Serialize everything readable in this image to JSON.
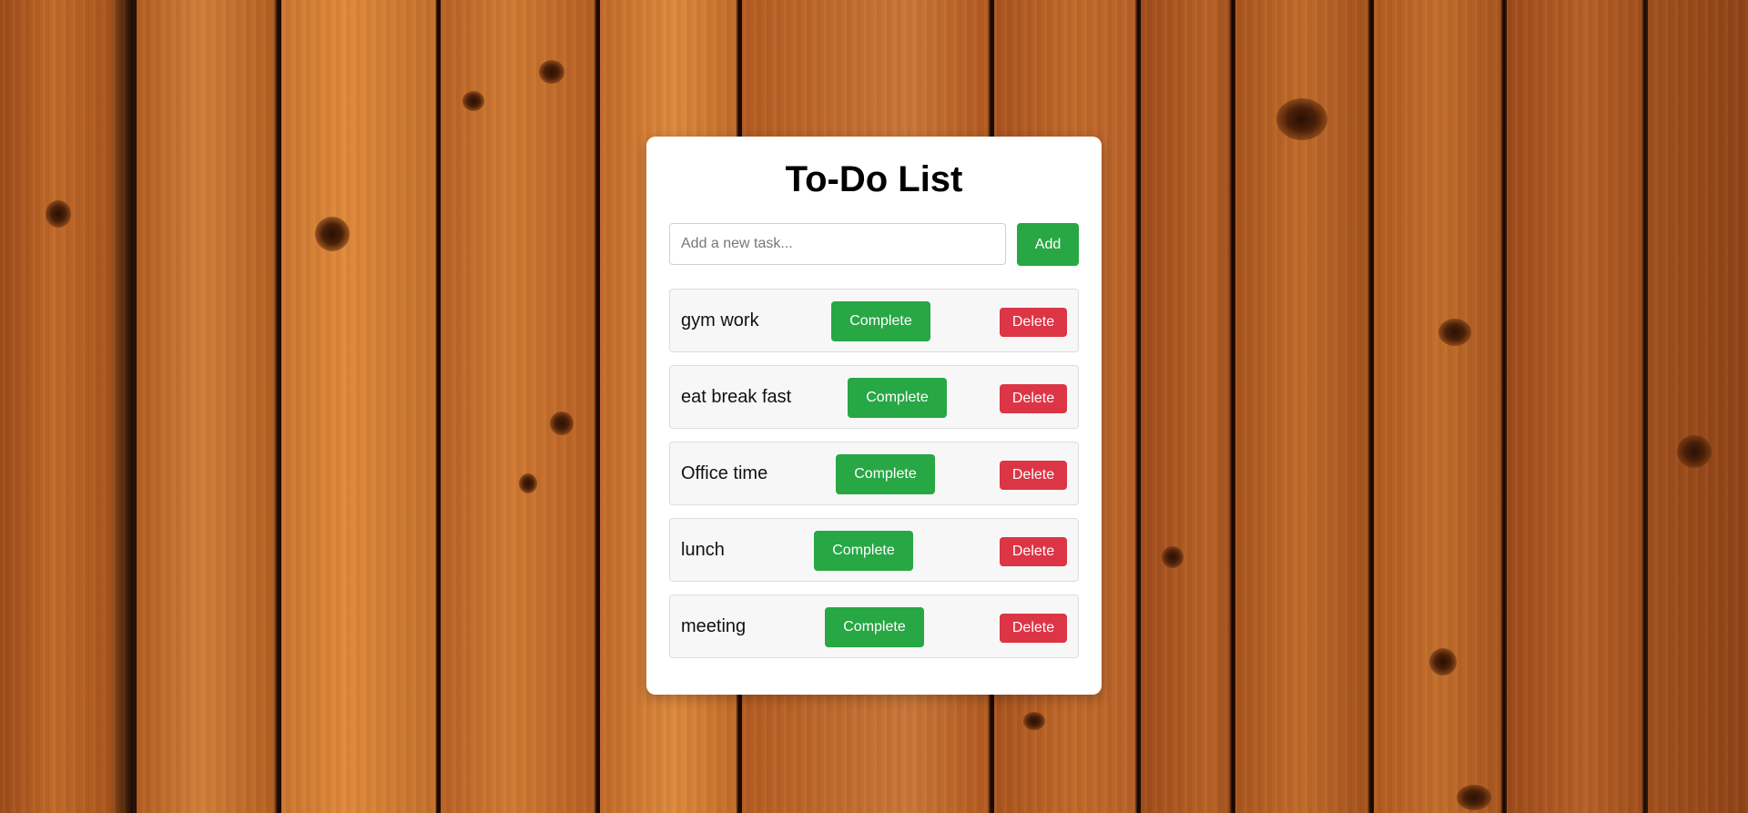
{
  "title": "To-Do List",
  "input": {
    "placeholder": "Add a new task...",
    "value": ""
  },
  "add_button_label": "Add",
  "tasks": [
    {
      "text": "gym work",
      "complete_label": "Complete",
      "delete_label": "Delete"
    },
    {
      "text": "eat break fast",
      "complete_label": "Complete",
      "delete_label": "Delete"
    },
    {
      "text": "Office time",
      "complete_label": "Complete",
      "delete_label": "Delete"
    },
    {
      "text": "lunch",
      "complete_label": "Complete",
      "delete_label": "Delete"
    },
    {
      "text": "meeting",
      "complete_label": "Complete",
      "delete_label": "Delete"
    }
  ],
  "colors": {
    "complete": "#28a745",
    "delete": "#dc3545",
    "card": "#ffffff"
  }
}
